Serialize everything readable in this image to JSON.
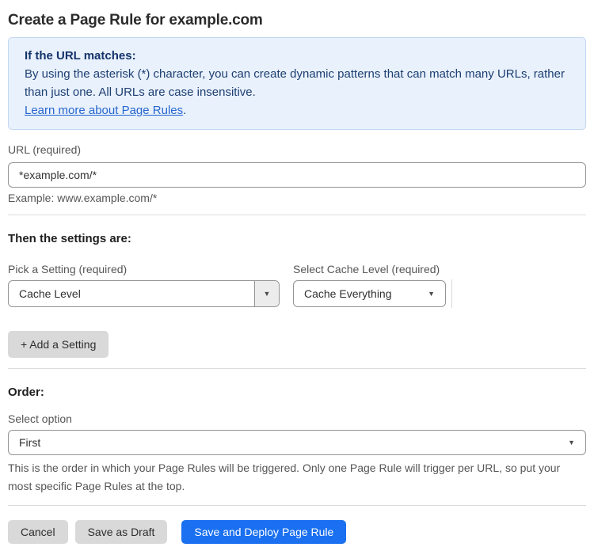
{
  "page": {
    "title": "Create a Page Rule for example.com"
  },
  "info_box": {
    "heading": "If the URL matches:",
    "body": "By using the asterisk (*) character, you can create dynamic patterns that can match many URLs, rather than just one. All URLs are case insensitive.",
    "link_label": "Learn more about Page Rules",
    "link_suffix": "."
  },
  "url_field": {
    "label": "URL (required)",
    "value": "*example.com/*",
    "example": "Example: www.example.com/*"
  },
  "settings_section": {
    "heading": "Then the settings are:",
    "setting_picker": {
      "label": "Pick a Setting (required)",
      "value": "Cache Level"
    },
    "cache_level_picker": {
      "label": "Select Cache Level (required)",
      "value": "Cache Everything"
    },
    "add_setting_label": "+ Add a Setting"
  },
  "order_section": {
    "heading": "Order:",
    "label": "Select option",
    "value": "First",
    "help": "This is the order in which your Page Rules will be triggered. Only one Page Rule will trigger per URL, so put your most specific Page Rules at the top."
  },
  "footer": {
    "cancel_label": "Cancel",
    "save_draft_label": "Save as Draft",
    "save_deploy_label": "Save and Deploy Page Rule"
  },
  "icons": {
    "caret_down": "▼"
  },
  "colors": {
    "accent_blue": "#1a70f0",
    "info_bg": "#e9f1fc",
    "info_border": "#c3d7f1",
    "info_text": "#1d3f72",
    "link_blue": "#2566cf",
    "button_gray": "#d9d9d9"
  }
}
